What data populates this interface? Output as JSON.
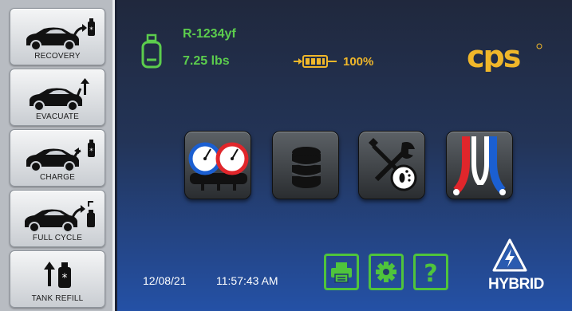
{
  "sidebar": {
    "items": [
      {
        "label": "RECOVERY",
        "icon": "car-recovery-icon"
      },
      {
        "label": "EVACUATE",
        "icon": "car-evacuate-icon"
      },
      {
        "label": "CHARGE",
        "icon": "car-charge-icon"
      },
      {
        "label": "FULL CYCLE",
        "icon": "car-full-cycle-icon"
      },
      {
        "label": "TANK REFILL",
        "icon": "tank-refill-icon"
      }
    ]
  },
  "status": {
    "refrigerant": "R-1234yf",
    "weight": "7.25 lbs",
    "battery_percent": "100%",
    "tank_icon": "refrigerant-tank-icon",
    "battery_icon": "battery-icon"
  },
  "brand": {
    "logo": "CPS",
    "logo_icon": "cps-logo"
  },
  "tiles": [
    {
      "icon": "manifold-gauges-icon"
    },
    {
      "icon": "database-icon"
    },
    {
      "icon": "service-tools-icon"
    },
    {
      "icon": "hoses-icon"
    }
  ],
  "footer": {
    "date": "12/08/21",
    "time": "11:57:43 AM",
    "buttons": [
      {
        "icon": "printer-icon"
      },
      {
        "icon": "gear-icon"
      },
      {
        "icon": "help-icon"
      }
    ],
    "hybrid_label": "HYBRID",
    "hybrid_icon": "high-voltage-warning-icon"
  },
  "colors": {
    "accent_green": "#5ccd4d",
    "accent_yellow": "#f0b72a",
    "gauge_blue": "#1b5fd1",
    "gauge_red": "#e0262b"
  }
}
